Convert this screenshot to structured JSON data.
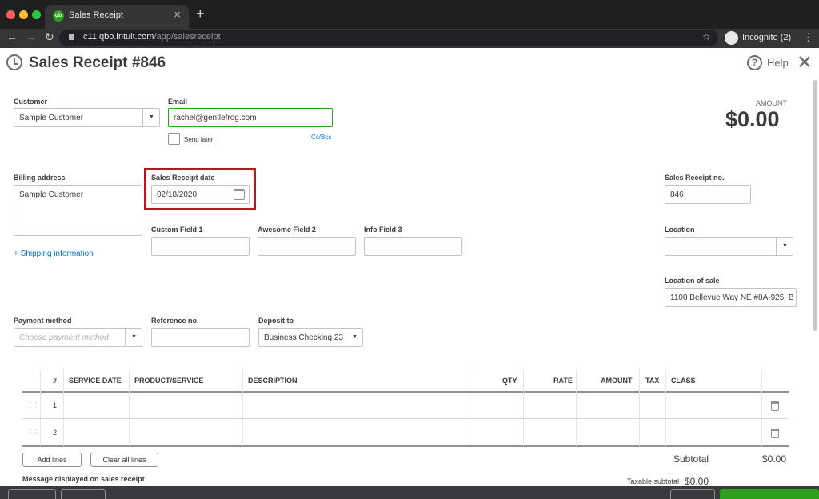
{
  "browser": {
    "tab_title": "Sales Receipt",
    "tab_close": "×",
    "new_tab": "+",
    "url_host": "c11.qbo.intuit.com",
    "url_path": "/app/salesreceipt",
    "profile_label": "Incognito (2)"
  },
  "form": {
    "title": "Sales Receipt #846",
    "help_label": "Help",
    "amount_label": "AMOUNT",
    "amount_value": "$0.00",
    "customer_label": "Customer",
    "customer_value": "Sample Customer",
    "email_label": "Email",
    "email_value": "rachel@gentlefrog.com",
    "send_later_label": "Send later",
    "cc_bcc_link": "Cc/Bcc",
    "billing_label": "Billing address",
    "billing_value": "Sample Customer",
    "receipt_date_label": "Sales Receipt date",
    "receipt_date_value": "02/18/2020",
    "receipt_no_label": "Sales Receipt no.",
    "receipt_no_value": "846",
    "custom_field_1_label": "Custom Field 1",
    "awesome_field_2_label": "Awesome Field 2",
    "info_field_3_label": "Info Field 3",
    "shipping_link": "+ Shipping information",
    "location_label": "Location",
    "location_of_sale_label": "Location of sale",
    "location_of_sale_value": "1100 Bellevue Way NE #8A-925, B",
    "payment_method_label": "Payment method",
    "payment_method_placeholder": "Choose payment method",
    "reference_label": "Reference no.",
    "deposit_label": "Deposit to",
    "deposit_value": "Business Checking 23"
  },
  "table": {
    "headers": {
      "num": "#",
      "service_date": "SERVICE DATE",
      "product": "PRODUCT/SERVICE",
      "description": "DESCRIPTION",
      "qty": "QTY",
      "rate": "RATE",
      "amount": "AMOUNT",
      "tax": "TAX",
      "class": "CLASS"
    },
    "rows": [
      "1",
      "2"
    ],
    "add_lines": "Add lines",
    "clear_all_lines": "Clear all lines"
  },
  "totals": {
    "subtotal_label": "Subtotal",
    "subtotal_value": "$0.00",
    "taxable_subtotal_label": "Taxable subtotal",
    "taxable_subtotal_value": "$0.00"
  },
  "message_label": "Message displayed on sales receipt",
  "colors": {
    "brand_green": "#2ca01c",
    "link_blue": "#0077c5",
    "highlight_red": "#b01b21"
  }
}
